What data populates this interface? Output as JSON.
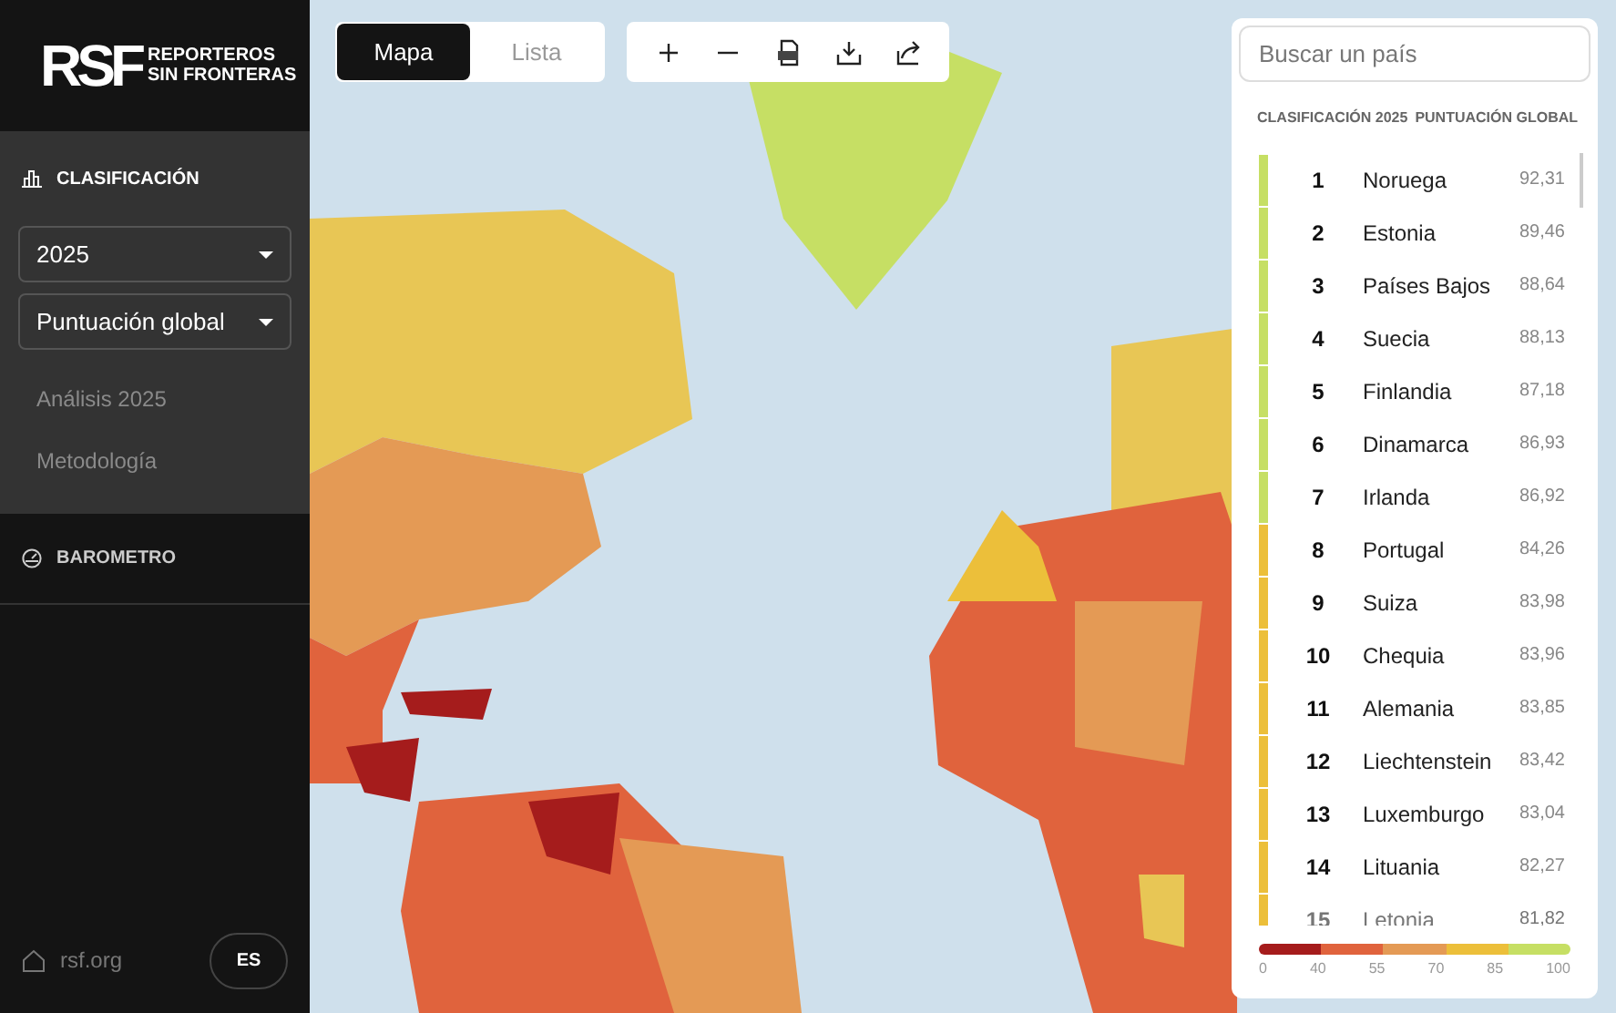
{
  "logo": {
    "mark": "RSF",
    "line_1": "REPORTEROS",
    "line_2": "SIN FRONTERAS"
  },
  "sidebar": {
    "section": {
      "title": "CLASIFICACIÓN",
      "expanded": true,
      "selects": [
        {
          "value": "2025"
        },
        {
          "value": "Puntuación global"
        }
      ],
      "links": [
        {
          "label": "Análisis 2025"
        },
        {
          "label": "Metodología"
        }
      ]
    },
    "section_2": {
      "title": "BAROMETRO",
      "expanded": false
    },
    "footer": {
      "link": "rsf.org",
      "language": "ES"
    }
  },
  "view_tabs": [
    {
      "label": "Mapa",
      "selected": true
    },
    {
      "label": "Lista",
      "selected": false
    }
  ],
  "toolbar": [
    {
      "kind": "plus"
    },
    {
      "kind": "minus"
    },
    {
      "kind": "pdf"
    },
    {
      "kind": "download"
    },
    {
      "kind": "share"
    }
  ],
  "ranking": {
    "search": {
      "placeholder": "Buscar un país"
    },
    "column_1": "CLASIFICACIÓN 2025",
    "column_2": "PUNTUACIÓN GLOBAL",
    "rows": [
      {
        "rank": "1",
        "country": "Noruega",
        "score": "92,31",
        "color": "#c6df64",
        "faded": false
      },
      {
        "rank": "2",
        "country": "Estonia",
        "score": "89,46",
        "color": "#c6df64",
        "faded": false
      },
      {
        "rank": "3",
        "country": "Países Bajos",
        "score": "88,64",
        "color": "#c6df64",
        "faded": false
      },
      {
        "rank": "4",
        "country": "Suecia",
        "score": "88,13",
        "color": "#c6df64",
        "faded": false
      },
      {
        "rank": "5",
        "country": "Finlandia",
        "score": "87,18",
        "color": "#c6df64",
        "faded": false
      },
      {
        "rank": "6",
        "country": "Dinamarca",
        "score": "86,93",
        "color": "#c6df64",
        "faded": false
      },
      {
        "rank": "7",
        "country": "Irlanda",
        "score": "86,92",
        "color": "#c6df64",
        "faded": false
      },
      {
        "rank": "8",
        "country": "Portugal",
        "score": "84,26",
        "color": "#ecbf3a",
        "faded": false
      },
      {
        "rank": "9",
        "country": "Suiza",
        "score": "83,98",
        "color": "#ecbf3a",
        "faded": false
      },
      {
        "rank": "10",
        "country": "Chequia",
        "score": "83,96",
        "color": "#ecbf3a",
        "faded": false
      },
      {
        "rank": "11",
        "country": "Alemania",
        "score": "83,85",
        "color": "#ecbf3a",
        "faded": false
      },
      {
        "rank": "12",
        "country": "Liechtenstein",
        "score": "83,42",
        "color": "#ecbf3a",
        "faded": false
      },
      {
        "rank": "13",
        "country": "Luxemburgo",
        "score": "83,04",
        "color": "#ecbf3a",
        "faded": false
      },
      {
        "rank": "14",
        "country": "Lituania",
        "score": "82,27",
        "color": "#ecbf3a",
        "faded": false
      },
      {
        "rank": "15",
        "country": "Letonia",
        "score": "81,82",
        "color": "#ecbf3a",
        "faded": true
      }
    ],
    "legend": {
      "segments": [
        {
          "color": "#a51c1c"
        },
        {
          "color": "#e0633d"
        },
        {
          "color": "#e49a55"
        },
        {
          "color": "#ecbf3a"
        },
        {
          "color": "#c6df64"
        }
      ],
      "ticks": [
        "0",
        "40",
        "55",
        "70",
        "85",
        "100"
      ]
    }
  }
}
